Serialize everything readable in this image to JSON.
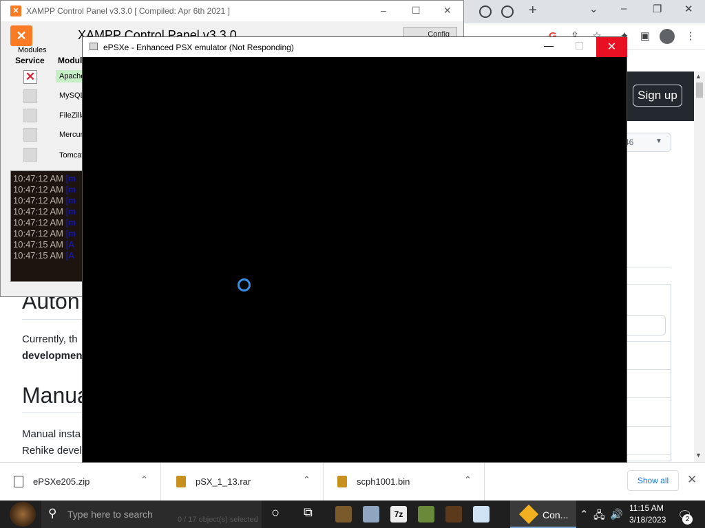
{
  "browser": {
    "signup_label": "Sign up",
    "select_value": "46",
    "headings": [
      "Auton",
      "Manua"
    ],
    "paragraph1_text": "Currently, th",
    "paragraph1_bold": "developmen",
    "paragraph2_line1": "Manual insta",
    "paragraph2_line2": "Rehike devel"
  },
  "downloads": {
    "items": [
      {
        "name": "ePSXe205.zip",
        "icon": "zip-file-icon"
      },
      {
        "name": "pSX_1_13.rar",
        "icon": "rar-file-icon"
      },
      {
        "name": "scph1001.bin",
        "icon": "bin-file-icon"
      }
    ],
    "show_all_label": "Show all"
  },
  "xampp": {
    "title": "XAMPP Control Panel v3.3.0   [ Compiled: Apr 6th 2021 ]",
    "heading": "XAMPP Control Panel v3.3.0",
    "config_label": "Config",
    "modules_label": "Modules",
    "col_service": "Service",
    "col_module": "Module",
    "modules": [
      {
        "name": "Apache",
        "running": true,
        "service_installed": true
      },
      {
        "name": "MySQL",
        "running": false,
        "service_installed": false
      },
      {
        "name": "FileZilla",
        "running": false,
        "service_installed": false
      },
      {
        "name": "Mercury",
        "running": false,
        "service_installed": false
      },
      {
        "name": "Tomcat",
        "running": false,
        "service_installed": false
      }
    ],
    "log": [
      {
        "time": "10:47:12 AM",
        "tag": "[m"
      },
      {
        "time": "10:47:12 AM",
        "tag": "[m"
      },
      {
        "time": "10:47:12 AM",
        "tag": "[m"
      },
      {
        "time": "10:47:12 AM",
        "tag": "[m"
      },
      {
        "time": "10:47:12 AM",
        "tag": "[m"
      },
      {
        "time": "10:47:12 AM",
        "tag": "[m"
      },
      {
        "time": "10:47:15 AM",
        "tag": "[A"
      },
      {
        "time": "10:47:15 AM",
        "tag": "[A"
      }
    ]
  },
  "epsxe": {
    "title": "ePSXe - Enhanced PSX emulator (Not Responding)"
  },
  "taskbar": {
    "search_placeholder": "Type here to search",
    "status_text": "0 / 17 object(s) selected",
    "active_app_label": "Con...",
    "time": "11:15 AM",
    "date": "3/18/2023",
    "notification_count": "2"
  },
  "colors": {
    "accent_close": "#e81123",
    "xampp_orange": "#fb7a24",
    "github_header": "#24292f",
    "spinner_blue": "#3a8ee6"
  }
}
